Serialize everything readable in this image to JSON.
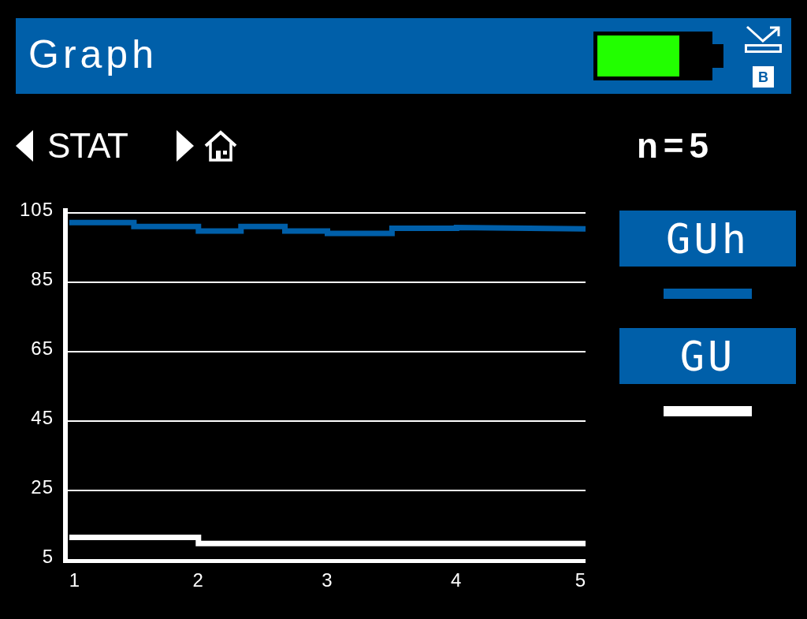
{
  "header": {
    "title": "Graph",
    "badge": "B"
  },
  "nav": [
    {
      "kind": "back",
      "label": "STAT"
    },
    {
      "kind": "home"
    }
  ],
  "count": "n=5",
  "graph": {
    "chart_data": {
      "type": "line",
      "grid": true,
      "x": [
        1,
        1.5,
        1.5,
        2,
        2,
        2.33,
        2.33,
        2.67,
        2.67,
        3,
        3,
        3.5,
        3.5,
        4,
        4,
        5
      ],
      "xlim": [
        1,
        5
      ],
      "ylim": [
        5,
        105
      ],
      "xticks": [
        1,
        2,
        3,
        4,
        5
      ],
      "yticks": [
        5,
        25,
        45,
        65,
        85,
        105
      ],
      "series": [
        {
          "name": "GUh",
          "color": "#005fa9",
          "values": [
            102.2,
            102.2,
            101.1,
            101.1,
            99.8,
            99.8,
            101.1,
            101.1,
            99.8,
            99.8,
            99.1,
            99.1,
            100.6,
            100.6,
            100.8,
            100.4
          ]
        },
        {
          "name": "GU",
          "color": "#ffffff",
          "values": [
            11.5,
            11.5,
            11.5,
            11.5,
            9.7,
            9.7,
            9.7,
            9.7,
            9.7,
            9.7,
            9.7,
            9.7,
            9.7,
            9.7,
            9.7,
            9.7
          ]
        }
      ]
    }
  }
}
